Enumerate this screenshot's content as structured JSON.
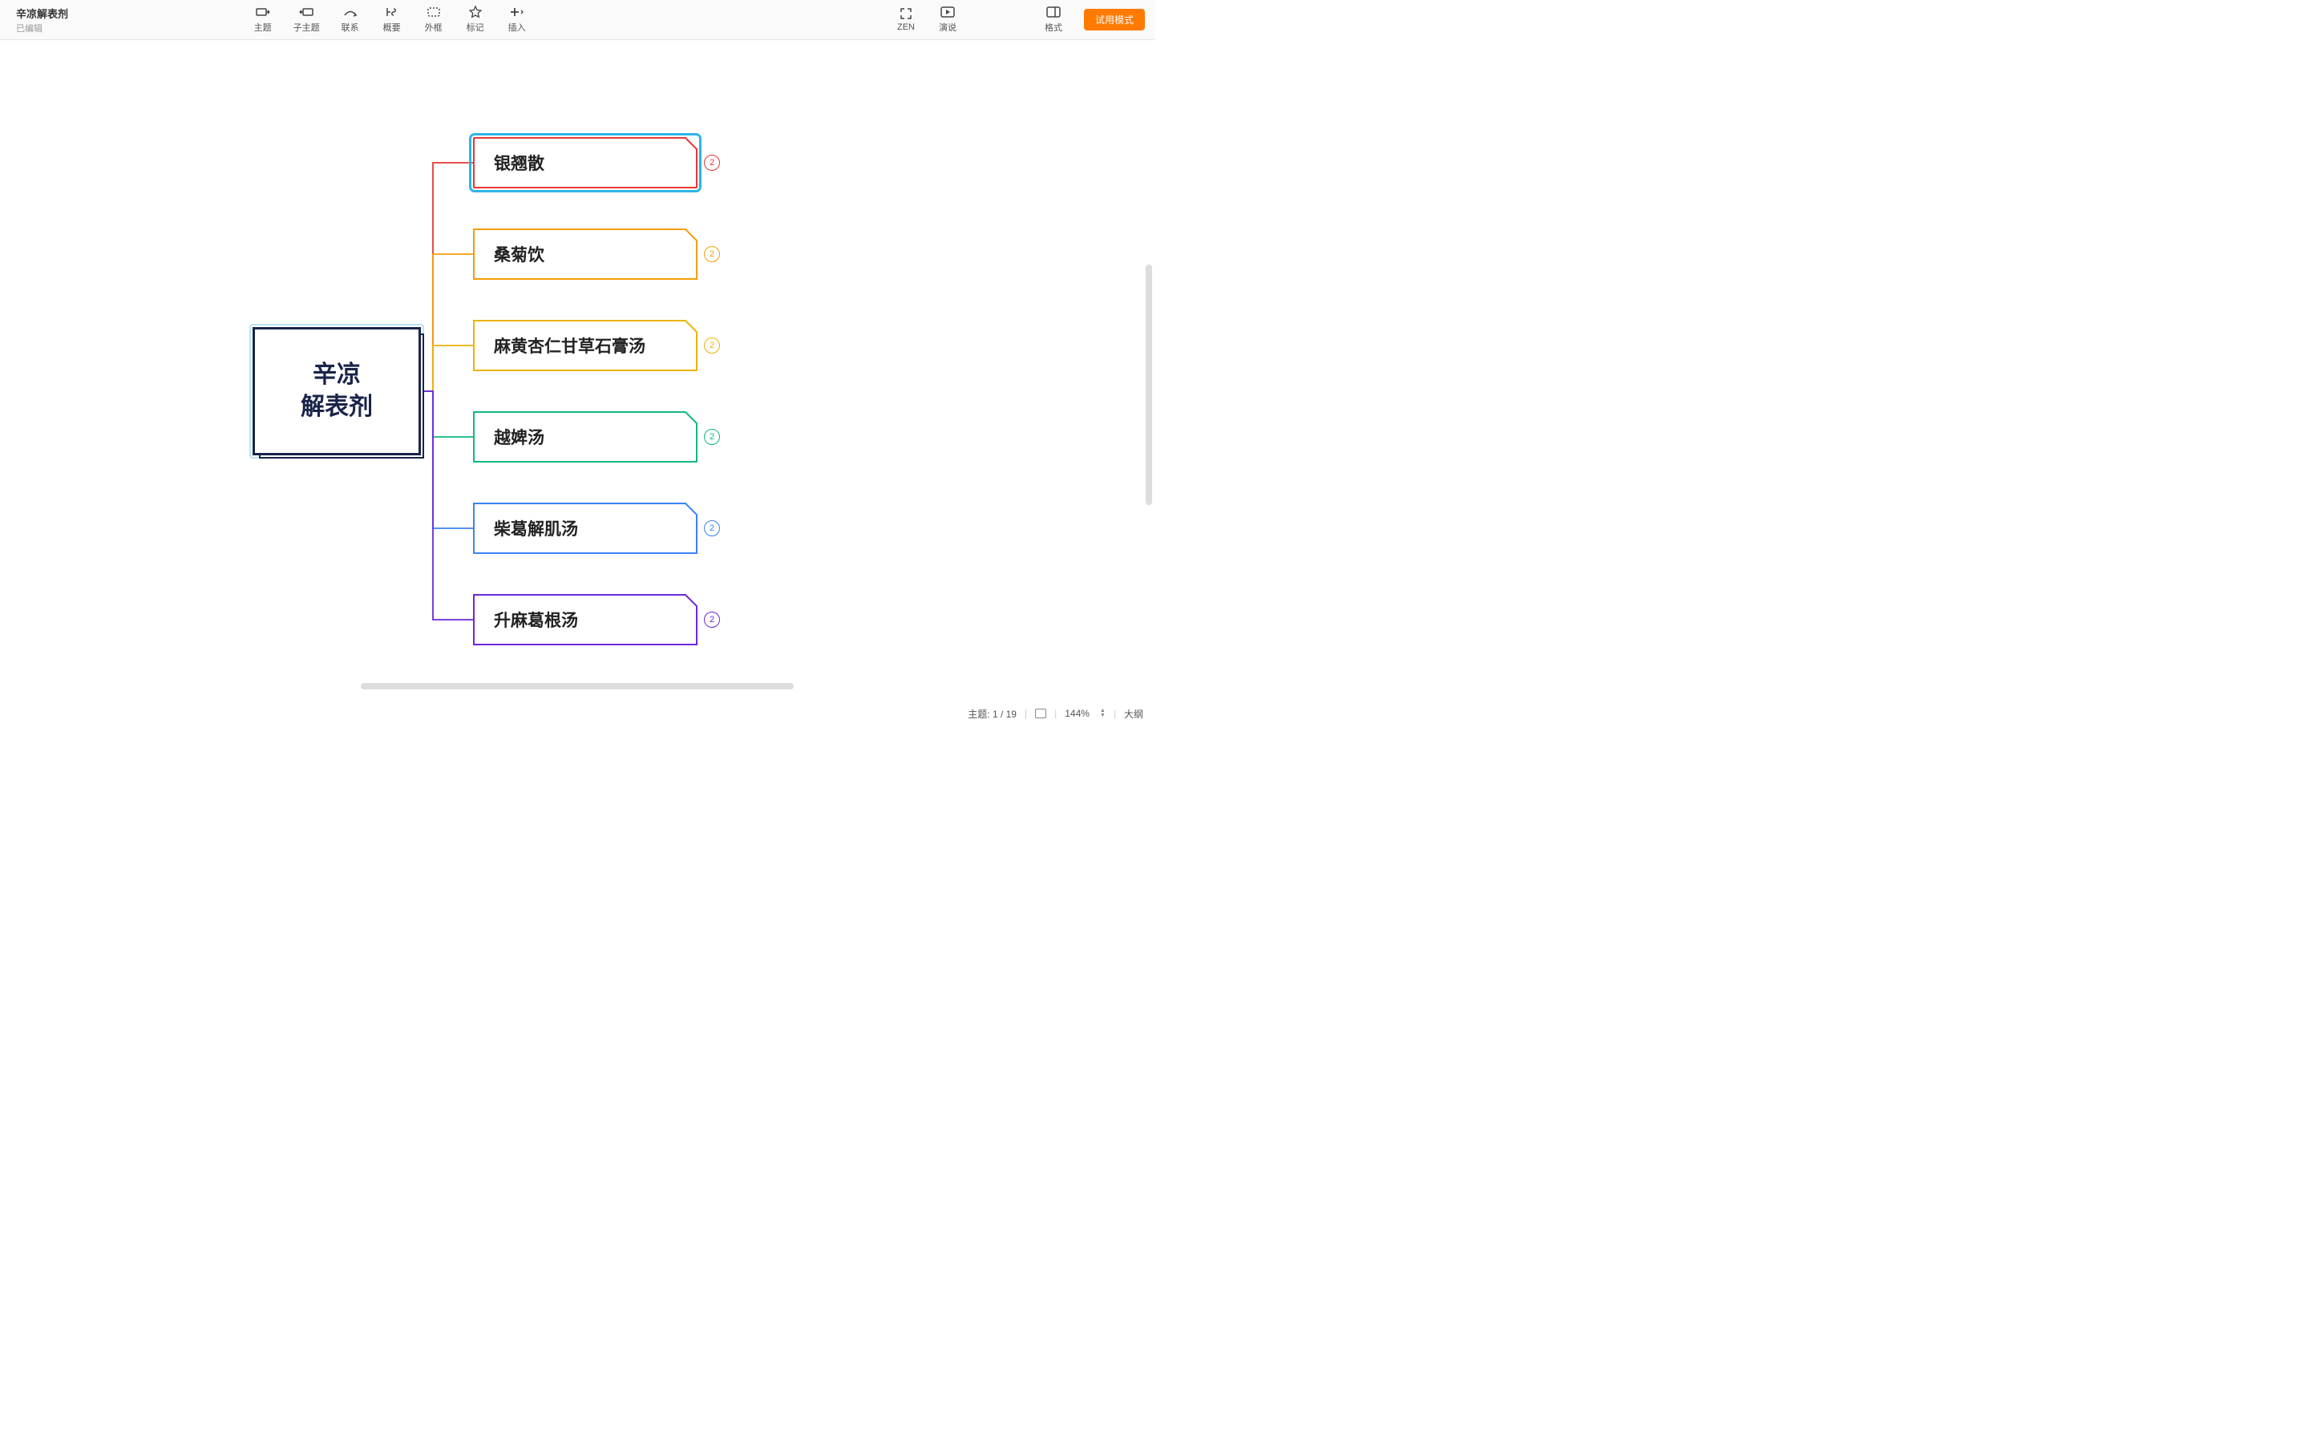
{
  "header": {
    "title": "辛凉解表剂",
    "status": "已编辑"
  },
  "toolbar": {
    "theme": "主题",
    "subtopic": "子主题",
    "relation": "联系",
    "summary": "概要",
    "boundary": "外框",
    "marker": "标记",
    "insert": "插入",
    "zen": "ZEN",
    "present": "演说",
    "format": "格式",
    "trial": "试用模式"
  },
  "mindmap": {
    "central": {
      "line1": "辛凉",
      "line2": "解表剂"
    },
    "nodes": [
      {
        "label": "银翘散",
        "color": "#e53935",
        "badge": "2",
        "selected": true
      },
      {
        "label": "桑菊饮",
        "color": "#f59e0b",
        "badge": "2",
        "selected": false
      },
      {
        "label": "麻黄杏仁甘草石膏汤",
        "color": "#eab308",
        "badge": "2",
        "selected": false
      },
      {
        "label": "越婢汤",
        "color": "#10b981",
        "badge": "2",
        "selected": false
      },
      {
        "label": "柴葛解肌汤",
        "color": "#3b82f6",
        "badge": "2",
        "selected": false
      },
      {
        "label": "升麻葛根汤",
        "color": "#6d28d9",
        "badge": "2",
        "selected": false
      }
    ]
  },
  "statusbar": {
    "topic_label": "主题:",
    "topic_pos": "1 / 19",
    "zoom": "144%",
    "outline": "大纲"
  }
}
